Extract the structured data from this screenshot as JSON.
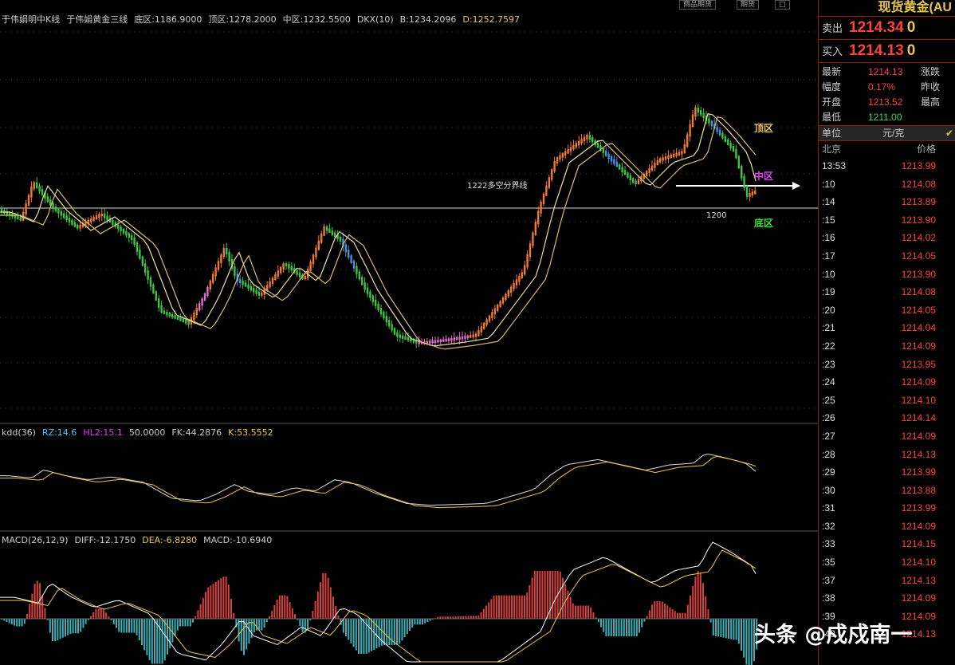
{
  "main_panel": {
    "header": [
      "于伟娟明中K线",
      "于伟娟黄金三线",
      "底区:1186.9000",
      "顶区:1278.2000",
      "中区:1232.5500",
      "DKX(10)",
      "B:1234.2096",
      "D:1252.7597"
    ],
    "header_colors": [
      "#ccc",
      "#ccc",
      "#ccc",
      "#ccc",
      "#ccc",
      "#ccc",
      "#ccc",
      "#e8c84a"
    ],
    "zones": {
      "top": "顶区",
      "mid": "中区",
      "bottom": "底区"
    },
    "annotations": {
      "line_label": "1222多空分界线",
      "level_label": "1200"
    }
  },
  "kdd_panel": {
    "header": [
      "kdd(36)",
      "RZ:14.6",
      "HL2:15.1",
      "50.0000",
      "FK:44.2876",
      "K:53.5552"
    ],
    "header_colors": [
      "#ccc",
      "#4fc3f7",
      "#e040fb",
      "#ccc",
      "#ccc",
      "#e8c84a"
    ]
  },
  "macd_panel": {
    "header": [
      "MACD(26,12,9)",
      "DIFF:-12.1750",
      "DEA:-6.8280",
      "MACD:-10.6940"
    ],
    "header_colors": [
      "#ccc",
      "#ccc",
      "#e8c84a",
      "#ccc"
    ]
  },
  "right_panel": {
    "title": "现货黄金(AU",
    "sell": {
      "label": "卖出",
      "price": "1214.34",
      "vol": "0"
    },
    "buy": {
      "label": "买入",
      "price": "1214.13",
      "vol": "0"
    },
    "stats": [
      {
        "label": "最新",
        "value": "1214.13",
        "color": "#ff4040",
        "label2": "涨跌"
      },
      {
        "label": "幅度",
        "value": "0.17%",
        "color": "#ff4040",
        "label2": "昨收"
      },
      {
        "label": "开盘",
        "value": "1213.52",
        "color": "#ff4040",
        "label2": "最高"
      },
      {
        "label": "最低",
        "value": "1211.00",
        "color": "#3fdc3f",
        "label2": ""
      }
    ],
    "unit_label": "单位",
    "unit_value": "元/克",
    "tick_header": {
      "time": "北京",
      "price": "价格"
    },
    "ticks": [
      {
        "time": "13:53",
        "price": "1213.99"
      },
      {
        "time": ":10",
        "price": "1214.08"
      },
      {
        "time": ":14",
        "price": "1213.89"
      },
      {
        "time": ":15",
        "price": "1213.90"
      },
      {
        "time": ":16",
        "price": "1214.02"
      },
      {
        "time": ":17",
        "price": "1214.05"
      },
      {
        "time": ":10",
        "price": "1213.90"
      },
      {
        "time": ":19",
        "price": "1214.08"
      },
      {
        "time": ":20",
        "price": "1214.05"
      },
      {
        "time": ":21",
        "price": "1214.04"
      },
      {
        "time": ":22",
        "price": "1214.09"
      },
      {
        "time": ":23",
        "price": "1213.95"
      },
      {
        "time": ":24",
        "price": "1214.09"
      },
      {
        "time": ":25",
        "price": "1214.10"
      },
      {
        "time": ":26",
        "price": "1214.14"
      },
      {
        "time": ":27",
        "price": "1214.09"
      },
      {
        "time": ":28",
        "price": "1214.13"
      },
      {
        "time": ":29",
        "price": "1213.99"
      },
      {
        "time": ":30",
        "price": "1213.88"
      },
      {
        "time": ":31",
        "price": "1213.99"
      },
      {
        "time": ":32",
        "price": "1214.09"
      },
      {
        "time": ":33",
        "price": "1214.15"
      },
      {
        "time": ":35",
        "price": "1214.10"
      },
      {
        "time": ":37",
        "price": "1214.13"
      },
      {
        "time": ":38",
        "price": "1214.09"
      },
      {
        "time": ":39",
        "price": "1214.09"
      },
      {
        "time": ":40",
        "price": "1214.13"
      }
    ]
  },
  "watermark": "头条 @戍戍南一",
  "top_buttons": [
    "商品期货",
    "期货",
    "□"
  ]
}
